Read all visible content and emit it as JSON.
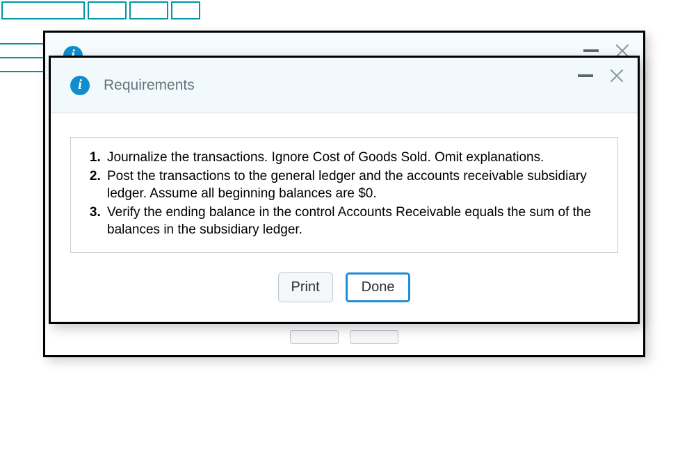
{
  "front_modal": {
    "title": "Requirements",
    "requirements": [
      "Journalize the transactions. Ignore Cost of Goods Sold. Omit explanations.",
      "Post the transactions to the general ledger and the accounts receivable subsidiary ledger. Assume all beginning balances are $0.",
      "Verify the ending balance in the control Accounts Receivable equals the sum of the balances in the subsidiary ledger."
    ],
    "buttons": {
      "print": "Print",
      "done": "Done"
    }
  },
  "icons": {
    "info_glyph": "i"
  }
}
